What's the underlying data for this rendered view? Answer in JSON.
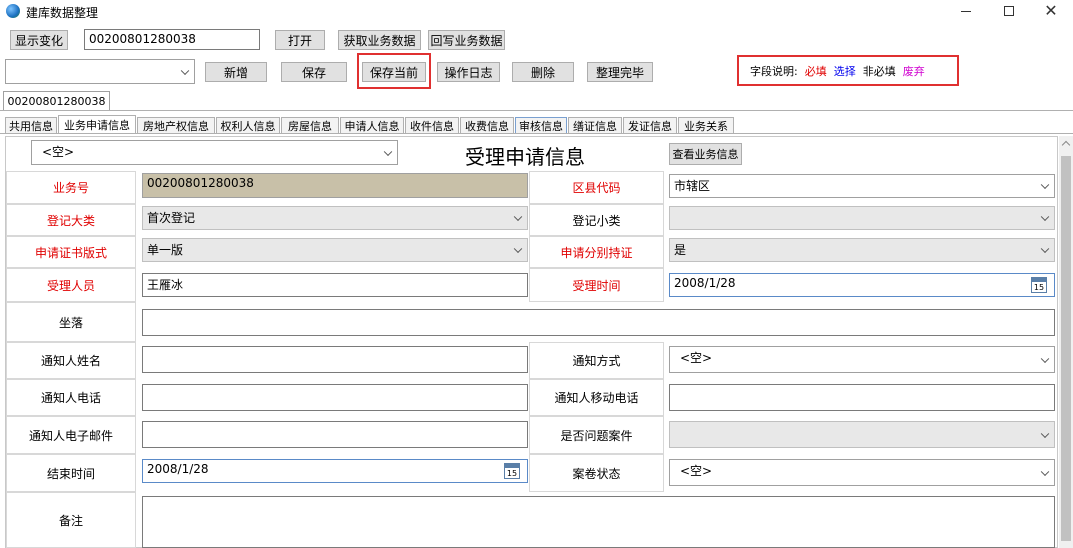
{
  "window": {
    "title": "建库数据整理",
    "min_icon": "minimize-icon",
    "max_icon": "maximize-icon",
    "close_icon": "close-icon"
  },
  "toolbar1": {
    "show_change": "显示变化",
    "id_value": "00200801280038",
    "open": "打开",
    "fetch": "获取业务数据",
    "writeback": "回写业务数据"
  },
  "toolbar2": {
    "select_value": "",
    "add": "新增",
    "save": "保存",
    "save_current": "保存当前",
    "op_log": "操作日志",
    "delete": "删除",
    "finish": "整理完毕"
  },
  "legend": {
    "label": "字段说明:",
    "required": "必填",
    "select": "选择",
    "optional": "非必填",
    "deprecated": "废弃",
    "colors": {
      "required": "#e00000",
      "select": "#0000ee",
      "optional": "#000000",
      "deprecated": "#d000d0"
    }
  },
  "doc_tab": "00200801280038",
  "tabs": [
    "共用信息",
    "业务申请信息",
    "房地产权信息",
    "权利人信息",
    "房屋信息",
    "申请人信息",
    "收件信息",
    "收费信息",
    "审核信息",
    "缮证信息",
    "发证信息",
    "业务关系"
  ],
  "form": {
    "top_select": "<空>",
    "title": "受理申请信息",
    "view_btn": "查看业务信息",
    "business_no_label": "业务号",
    "business_no": "00200801280038",
    "district_label": "区县代码",
    "district": "市辖区",
    "reg_major_label": "登记大类",
    "reg_major": "首次登记",
    "reg_minor_label": "登记小类",
    "reg_minor": "",
    "cert_format_label": "申请证书版式",
    "cert_format": "单一版",
    "separate_cert_label": "申请分别持证",
    "separate_cert": "是",
    "receiver_label": "受理人员",
    "receiver": "王雁冰",
    "receive_time_label": "受理时间",
    "receive_time": "2008/1/28",
    "location_label": "坐落",
    "location": "",
    "notify_name_label": "通知人姓名",
    "notify_name": "",
    "notify_method_label": "通知方式",
    "notify_method": "<空>",
    "notify_phone_label": "通知人电话",
    "notify_phone": "",
    "notify_mobile_label": "通知人移动电话",
    "notify_mobile": "",
    "notify_email_label": "通知人电子邮件",
    "notify_email": "",
    "problem_case_label": "是否问题案件",
    "problem_case": "",
    "end_time_label": "结束时间",
    "end_time": "2008/1/28",
    "archive_status_label": "案卷状态",
    "archive_status": "<空>",
    "remark_label": "备注",
    "remark": "",
    "cal_day": "15"
  }
}
